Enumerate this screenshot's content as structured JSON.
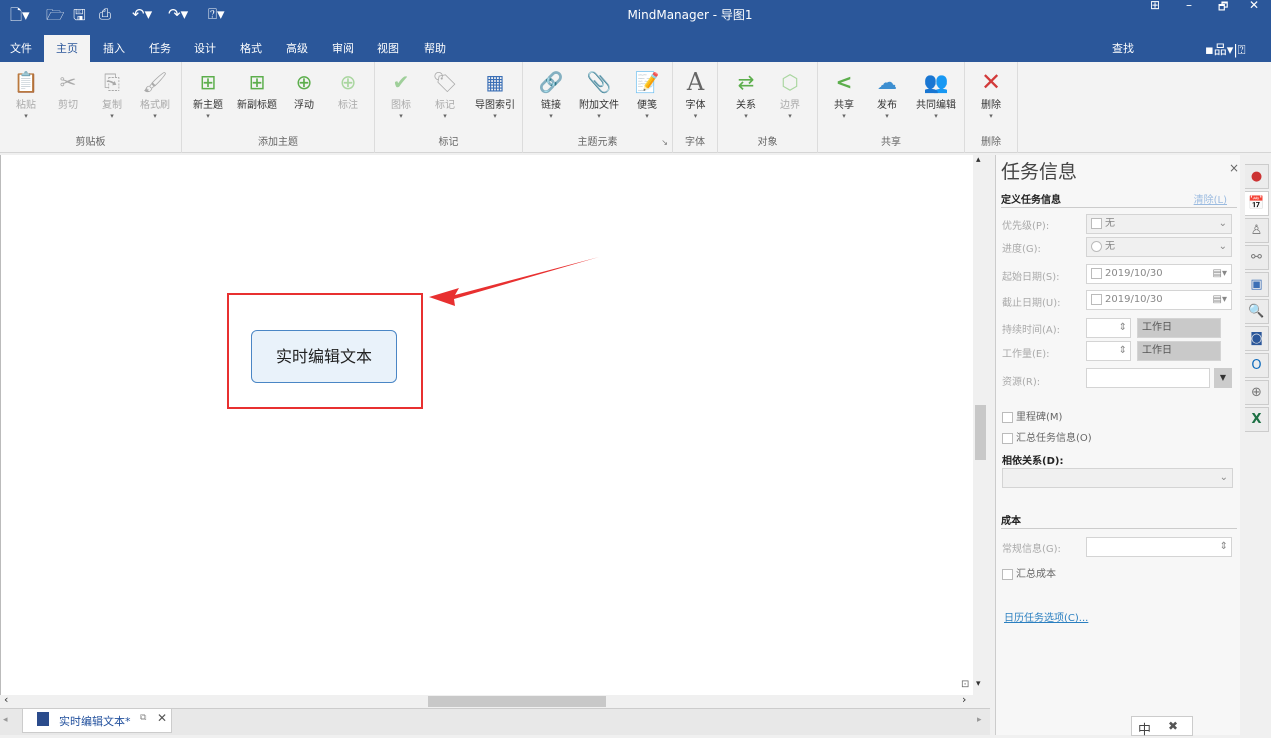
{
  "title": "MindManager - 导图1",
  "window_controls": [
    "⊞",
    "–",
    "🗗",
    "✕"
  ],
  "quick_access": {
    "icons": [
      "new-icon",
      "open-icon",
      "save-icon",
      "print-icon",
      "undo-icon",
      "redo-icon",
      "help-icon"
    ]
  },
  "tabs": [
    "文件",
    "主页",
    "插入",
    "任务",
    "设计",
    "格式",
    "高级",
    "审阅",
    "视图",
    "帮助"
  ],
  "active_tab": "主页",
  "search_label": "查找",
  "ribbon": {
    "groups": [
      {
        "label": "剪贴板",
        "buttons": [
          {
            "label": "粘贴",
            "icon": "📋"
          },
          {
            "label": "剪切",
            "icon": "✂"
          },
          {
            "label": "复制",
            "icon": "⎘"
          },
          {
            "label": "格式刷",
            "icon": "🖌"
          }
        ]
      },
      {
        "label": "添加主题",
        "buttons": [
          {
            "label": "新主题",
            "icon": "⊞"
          },
          {
            "label": "新副标题",
            "icon": "⊞"
          },
          {
            "label": "浮动",
            "icon": "⊕"
          },
          {
            "label": "标注",
            "icon": "⊕"
          }
        ]
      },
      {
        "label": "标记",
        "buttons": [
          {
            "label": "图标",
            "icon": "✔"
          },
          {
            "label": "标记",
            "icon": "🏷"
          },
          {
            "label": "导图索引",
            "icon": "▦"
          }
        ]
      },
      {
        "label": "主题元素",
        "buttons": [
          {
            "label": "链接",
            "icon": "🔗"
          },
          {
            "label": "附加文件",
            "icon": "📎"
          },
          {
            "label": "便笺",
            "icon": "📝"
          }
        ]
      },
      {
        "label": "字体",
        "buttons": [
          {
            "label": "字体",
            "icon": "A"
          }
        ]
      },
      {
        "label": "对象",
        "buttons": [
          {
            "label": "关系",
            "icon": "⇄"
          },
          {
            "label": "边界",
            "icon": "⬡"
          }
        ]
      },
      {
        "label": "共享",
        "buttons": [
          {
            "label": "共享",
            "icon": "<"
          },
          {
            "label": "发布",
            "icon": "☁"
          },
          {
            "label": "共同编辑",
            "icon": "👥"
          }
        ]
      },
      {
        "label": "删除",
        "buttons": [
          {
            "label": "删除",
            "icon": "✕"
          }
        ]
      }
    ]
  },
  "canvas": {
    "topic_text": "实时编辑文本",
    "highlight_color": "#e83030"
  },
  "doc_tab": {
    "label": "实时编辑文本*"
  },
  "panel": {
    "title": "任务信息",
    "section1": "定义任务信息",
    "clear_link": "清除(L)",
    "priority_label": "优先级(P):",
    "priority_value": "无",
    "progress_label": "进度(G):",
    "progress_value": "无",
    "start_label": "起始日期(S):",
    "start_value": "2019/10/30",
    "due_label": "截止日期(U):",
    "due_value": "2019/10/30",
    "duration_label": "持续时间(A):",
    "duration_unit": "工作日",
    "effort_label": "工作量(E):",
    "effort_unit": "工作日",
    "resource_label": "资源(R):",
    "milestone_label": "里程碑(M)",
    "rollup_label": "汇总任务信息(O)",
    "dependency_label": "相依关系(D):",
    "section2": "成本",
    "general_label": "常规信息(G):",
    "rollup_cost_label": "汇总成本",
    "calendar_link": "日历任务选项(C)..."
  },
  "ime": [
    "中",
    "✖"
  ]
}
